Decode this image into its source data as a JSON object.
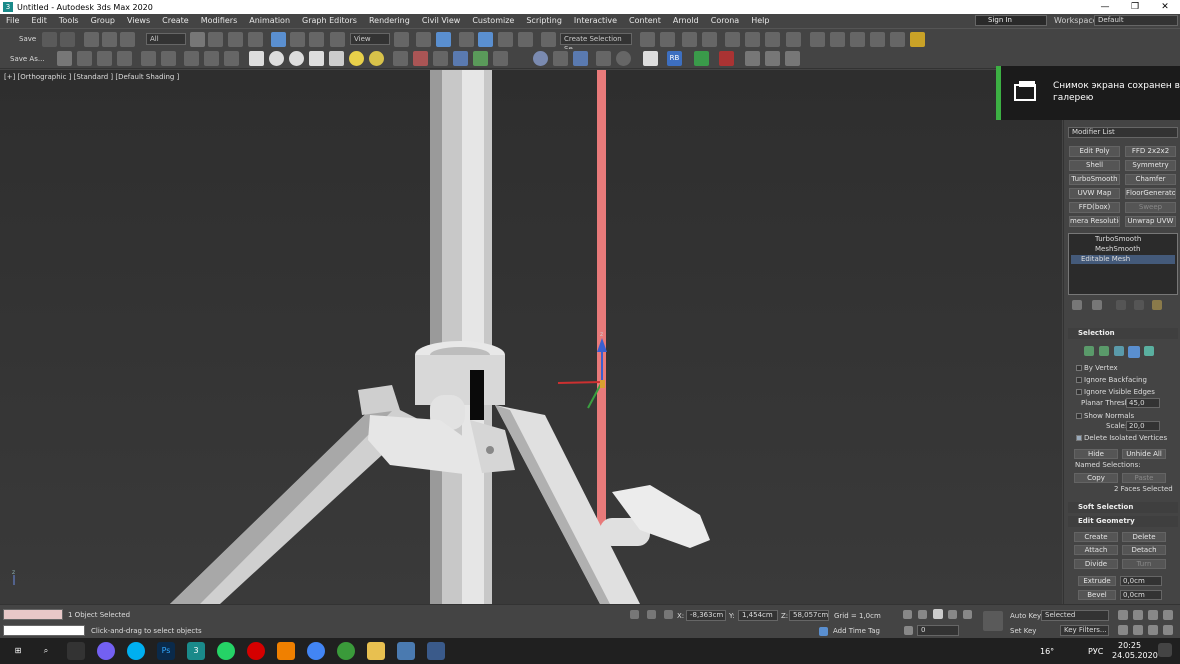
{
  "window": {
    "title": "Untitled - Autodesk 3ds Max 2020",
    "minimize": "—",
    "maximize": "❒",
    "close": "✕"
  },
  "menu": [
    "File",
    "Edit",
    "Tools",
    "Group",
    "Views",
    "Create",
    "Modifiers",
    "Animation",
    "Graph Editors",
    "Rendering",
    "Civil View",
    "Customize",
    "Scripting",
    "Interactive",
    "Content",
    "Arnold",
    "Corona",
    "Help"
  ],
  "account": {
    "sign_in": "Sign In",
    "workspaces_label": "Workspaces:",
    "workspace": "Default"
  },
  "toolbar": {
    "save": "Save",
    "save_as": "Save As...",
    "filter": "All",
    "ref_coord": "View",
    "selection_set": "Create Selection Se",
    "rb_label": "RB"
  },
  "viewport": {
    "label": "[+] [Orthographic ] [Standard ] [Default Shading ]",
    "axis_z": "z",
    "gizmo_z": "z"
  },
  "notification": {
    "text": "Снимок экрана сохранен в галерею"
  },
  "command_panel": {
    "modifier_list": "Modifier List",
    "buttons": [
      {
        "label": "Edit Poly",
        "enabled": true
      },
      {
        "label": "FFD 2x2x2",
        "enabled": true
      },
      {
        "label": "Shell",
        "enabled": true
      },
      {
        "label": "Symmetry",
        "enabled": true
      },
      {
        "label": "TurboSmooth",
        "enabled": true
      },
      {
        "label": "Chamfer",
        "enabled": true
      },
      {
        "label": "UVW Map",
        "enabled": true
      },
      {
        "label": "FloorGenerator",
        "enabled": true
      },
      {
        "label": "FFD(box)",
        "enabled": true
      },
      {
        "label": "Sweep",
        "enabled": false
      },
      {
        "label": "mera Resolution M",
        "enabled": true
      },
      {
        "label": "Unwrap UVW",
        "enabled": true
      }
    ],
    "stack": [
      "TurboSmooth",
      "MeshSmooth",
      "Editable Mesh"
    ],
    "selection": {
      "title": "Selection",
      "by_vertex": "By Vertex",
      "ignore_backfacing": "Ignore Backfacing",
      "ignore_visible_edges": "Ignore Visible Edges",
      "planar_thresh_label": "Planar Thresh:",
      "planar_thresh": "45,0",
      "show_normals": "Show Normals",
      "scale_label": "Scale:",
      "scale": "20,0",
      "delete_isolated": "Delete Isolated Vertices",
      "hide": "Hide",
      "unhide_all": "Unhide All",
      "named_selections": "Named Selections:",
      "copy": "Copy",
      "paste": "Paste",
      "status": "2 Faces Selected"
    },
    "soft_selection": {
      "title": "Soft Selection"
    },
    "edit_geometry": {
      "title": "Edit Geometry",
      "create": "Create",
      "delete": "Delete",
      "attach": "Attach",
      "detach": "Detach",
      "divide": "Divide",
      "turn": "Turn",
      "extrude": "Extrude",
      "extrude_val": "0,0cm",
      "bevel": "Bevel",
      "bevel_val": "0,0cm"
    }
  },
  "status": {
    "objects_selected": "1 Object Selected",
    "prompt": "Click-and-drag to select objects",
    "x_label": "X:",
    "x": "-8,363cm",
    "y_label": "Y:",
    "y": "1,454cm",
    "z_label": "Z:",
    "z": "58,057cm",
    "grid": "Grid = 1,0cm",
    "add_time_tag": "Add Time Tag",
    "auto_key": "Auto Key",
    "set_key": "Set Key",
    "selected": "Selected",
    "key_filters": "Key Filters...",
    "frame": "0"
  },
  "taskbar": {
    "lang": "РУС",
    "time": "20:25",
    "date": "24.05.2020",
    "temp": "16°"
  },
  "colors": {
    "accent_green": "#3cb043",
    "selection_blue": "#5a8fd0",
    "red_rod": "#e87a7a"
  }
}
